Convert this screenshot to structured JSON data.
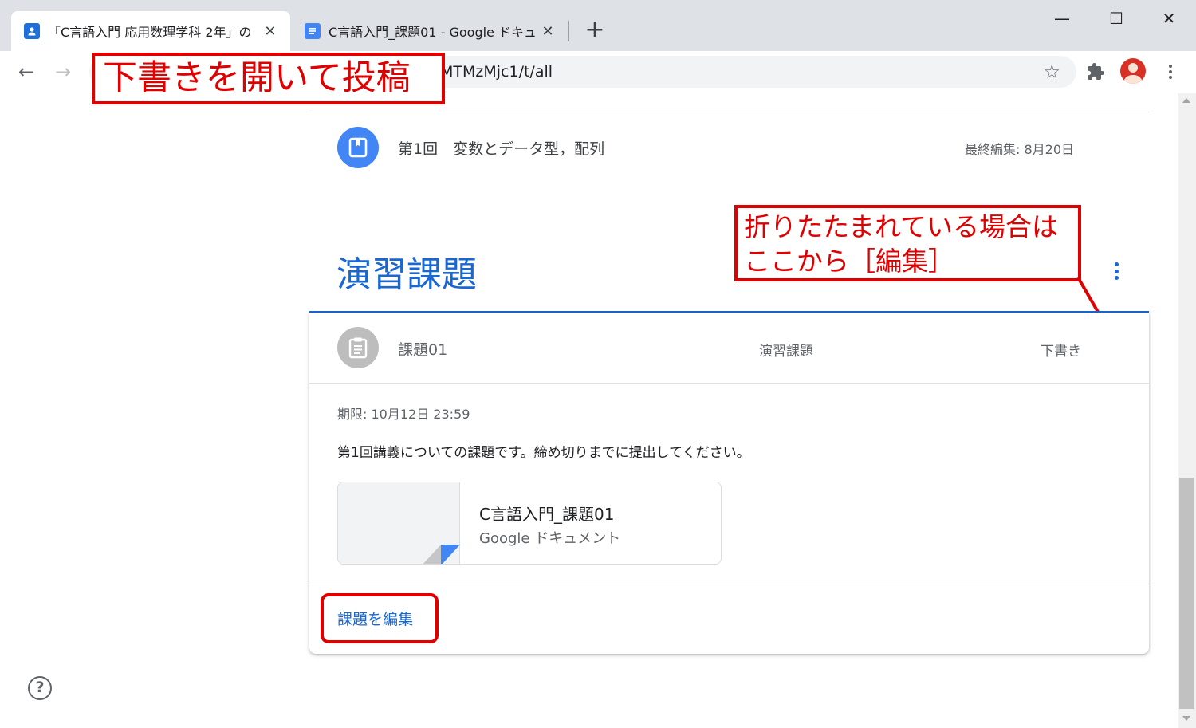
{
  "tabs": [
    {
      "title": "「C言語入門 応用数理学科 2年」の",
      "active": true,
      "icon": "classroom-icon"
    },
    {
      "title": "C言語入門_課題01 - Google ドキュ",
      "active": false,
      "icon": "docs-icon"
    }
  ],
  "window_controls": {
    "minimize": "—",
    "maximize": "☐",
    "close": "✕"
  },
  "toolbar": {
    "back": "←",
    "forward": "→",
    "url_visible": "MTMzMjc1/t/all",
    "star": "☆"
  },
  "annotations": {
    "draft_post": "下書きを開いて投稿",
    "collapsed_hint_line1": "折りたたまれている場合は",
    "collapsed_hint_line2": "ここから［編集］"
  },
  "material": {
    "title": "第1回　変数とデータ型，配列",
    "edited": "最終編集: 8月20日"
  },
  "section": {
    "title": "演習課題"
  },
  "assignment": {
    "title": "課題01",
    "topic": "演習課題",
    "status": "下書き",
    "due": "期限: 10月12日 23:59",
    "description": "第1回講義についての課題です。締め切りまでに提出してください。",
    "attachment": {
      "name": "C言語入門_課題01",
      "type": "Google ドキュメント"
    },
    "edit_label": "課題を編集"
  },
  "colors": {
    "accent": "#1967d2",
    "annotation": "#e00000",
    "material_icon": "#4285f4"
  }
}
